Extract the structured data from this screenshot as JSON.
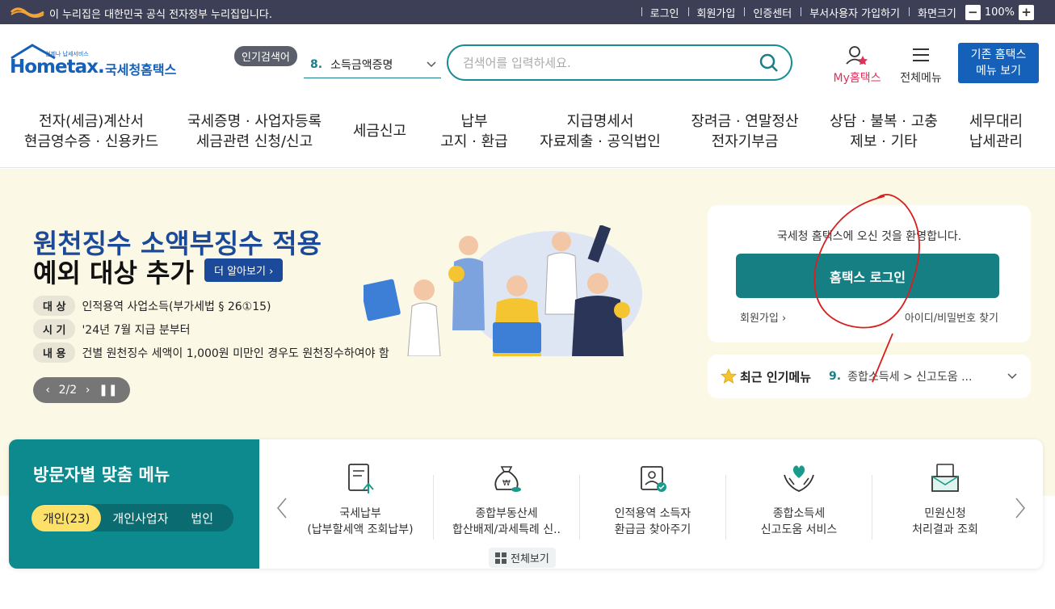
{
  "topbar": {
    "gov_notice": "이 누리집은 대한민국 공식 전자정부 누리집입니다.",
    "links": [
      "로그인",
      "회원가입",
      "인증센터",
      "부서사용자 가입하기",
      "화면크기"
    ],
    "zoom_minus": "−",
    "zoom_value": "100%",
    "zoom_plus": "+"
  },
  "header": {
    "logo_small": "언제나 납세서비스",
    "logo_main": "Hometax.",
    "logo_kor": "국세청홈택스",
    "popular_badge": "인기검색어",
    "popular_num": "8.",
    "popular_term": "소득금액증명",
    "search_placeholder": "검색어를 입력하세요.",
    "my_prefix": "My",
    "my_suffix": "홈택스",
    "all_menu": "전체메뉴",
    "old_btn_line1": "기존 홈택스",
    "old_btn_line2": "메뉴 보기"
  },
  "gnb": [
    {
      "line1": "전자(세금)계산서",
      "line2": "현금영수증 · 신용카드"
    },
    {
      "line1": "국세증명 · 사업자등록",
      "line2": "세금관련 신청/신고"
    },
    {
      "line1": "세금신고",
      "line2": ""
    },
    {
      "line1": "납부",
      "line2": "고지 · 환급"
    },
    {
      "line1": "지급명세서",
      "line2": "자료제출 · 공익법인"
    },
    {
      "line1": "장려금 · 연말정산",
      "line2": "전자기부금"
    },
    {
      "line1": "상담 · 불복 · 고충",
      "line2": "제보 · 기타"
    },
    {
      "line1": "세무대리",
      "line2": "납세관리"
    }
  ],
  "hero": {
    "title1": "원천징수 소액부징수 적용",
    "title2": "예외 대상 추가",
    "more_btn": "더 알아보기 ›",
    "rows": [
      {
        "tag": "대 상",
        "text": "인적용역 사업소득(부가세법 § 26①15)"
      },
      {
        "tag": "시 기",
        "text": "'24년 7월 지급 분부터"
      },
      {
        "tag": "내 용",
        "text": "건별 원천징수 세액이 1,000원 미만인 경우도 원천징수하여야 함"
      }
    ],
    "pager": "2/2"
  },
  "login": {
    "welcome": "국세청 홈택스에 오신 것을 환영합니다.",
    "button": "홈택스 로그인",
    "join": "회원가입 ›",
    "find": "아이디/비밀번호 찾기"
  },
  "recent": {
    "title": "최근 인기메뉴",
    "num": "9.",
    "text": "종합소득세 > 신고도움 ..."
  },
  "visitor": {
    "title": "방문자별 맞춤 메뉴",
    "tabs": [
      "개인(23)",
      "개인사업자",
      "법인"
    ],
    "cards": [
      {
        "line1": "국세납부",
        "line2": "(납부할세액 조회납부)",
        "icon": "document-upload-icon"
      },
      {
        "line1": "종합부동산세",
        "line2": "합산배제/과세특례 신..",
        "icon": "money-bag-icon"
      },
      {
        "line1": "인적용역 소득자",
        "line2": "환급금 찾아주기",
        "icon": "user-badge-icon"
      },
      {
        "line1": "종합소득세",
        "line2": "신고도움 서비스",
        "icon": "heart-hands-icon"
      },
      {
        "line1": "민원신청",
        "line2": "처리결과 조회",
        "icon": "folder-icon"
      }
    ],
    "view_all": "전체보기"
  },
  "colors": {
    "teal": "#167f84",
    "navy": "#1a4a99",
    "topbar": "#3c3f55",
    "hero_bg": "#fcf8e6",
    "accent_yellow": "#fce068"
  }
}
